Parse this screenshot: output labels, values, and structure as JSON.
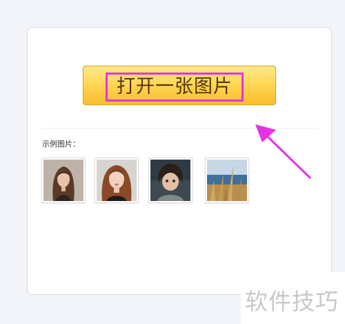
{
  "main": {
    "open_button_label": "打开一张图片",
    "examples_label": "示例图片：",
    "example_images": [
      {
        "icon": "portrait-woman-dark-hair"
      },
      {
        "icon": "portrait-woman-red-hair"
      },
      {
        "icon": "portrait-child"
      },
      {
        "icon": "grass-by-sea"
      }
    ]
  },
  "annotation": {
    "highlight_color": "#e333e5",
    "arrow_icon": "pointer-arrow-icon"
  },
  "watermark": {
    "text": "软件技巧"
  },
  "colors": {
    "button_top": "#ffe889",
    "button_bottom": "#f9bf2c",
    "button_text": "#5a3512"
  }
}
